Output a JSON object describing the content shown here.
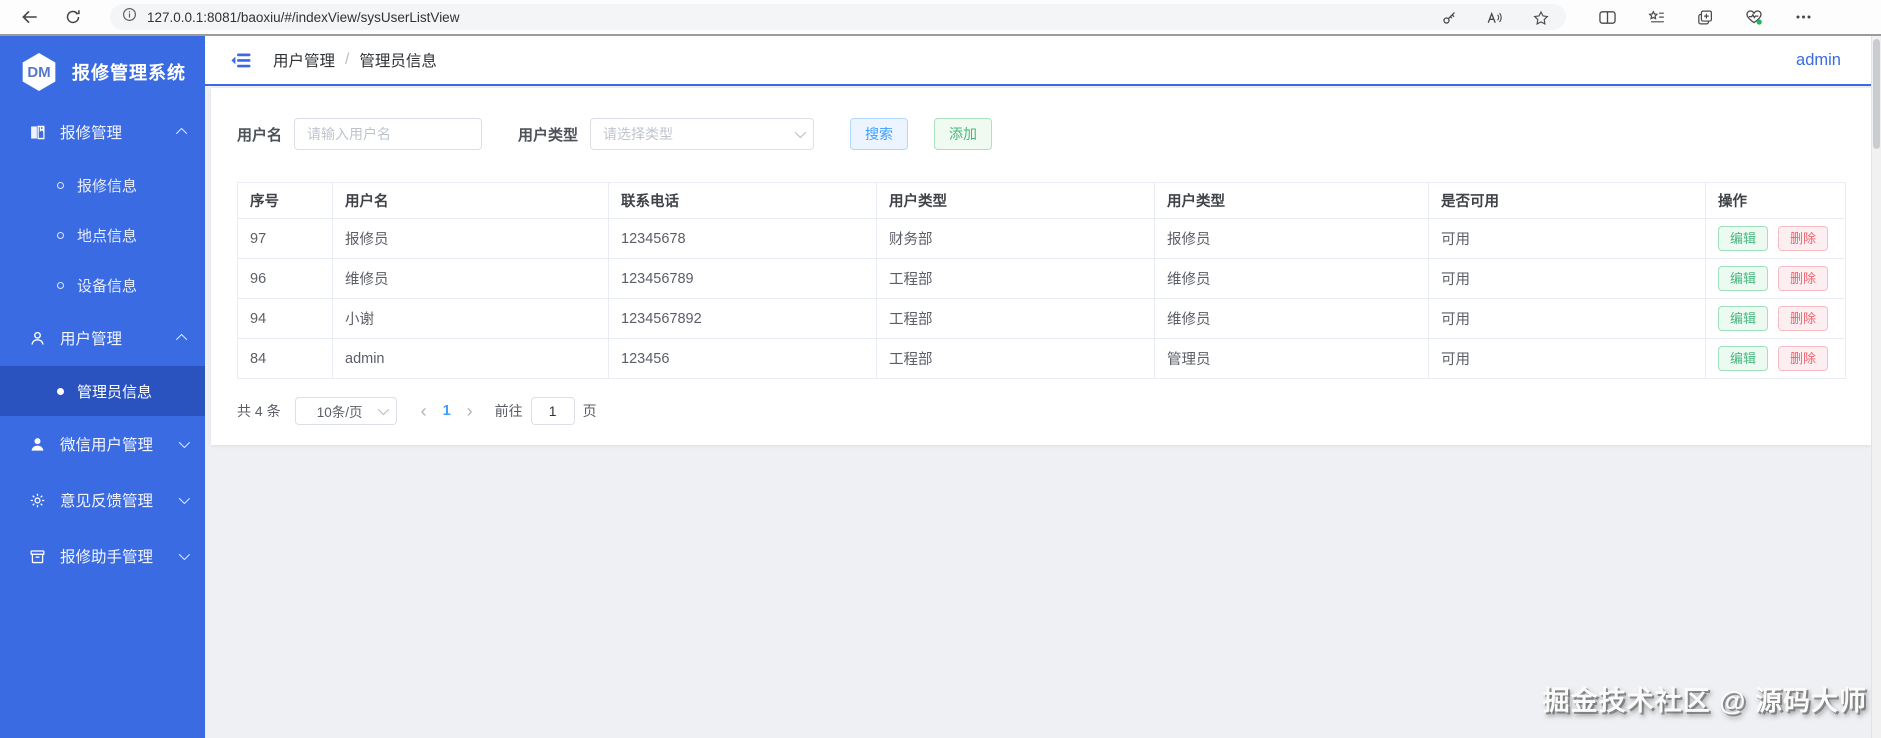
{
  "browser": {
    "url": "127.0.0.1:8081/baoxiu/#/indexView/sysUserListView",
    "icons": {
      "back": "left-arrow",
      "refresh": "circular-arrow",
      "site_info": "circled-i",
      "password_key": "key",
      "read_aloud": "A-with-sound-waves",
      "favorite_star": "star-outline",
      "split_screen": "rect-split",
      "favorites_hub": "star-with-lines",
      "collections": "stacked-panels-plus",
      "essentials": "heart-pulse-green-dot",
      "more": "ellipsis"
    }
  },
  "sidebar": {
    "logo_text": "DM",
    "title": "报修管理系统",
    "items": [
      {
        "key": "repair-management",
        "label": "报修管理",
        "type": "group",
        "icon": "book",
        "expanded": true
      },
      {
        "key": "repair-info",
        "label": "报修信息",
        "type": "sub",
        "active": false
      },
      {
        "key": "location-info",
        "label": "地点信息",
        "type": "sub",
        "active": false
      },
      {
        "key": "device-info",
        "label": "设备信息",
        "type": "sub",
        "active": false
      },
      {
        "key": "user-management",
        "label": "用户管理",
        "type": "group",
        "icon": "user-outline",
        "expanded": true
      },
      {
        "key": "admin-info",
        "label": "管理员信息",
        "type": "sub",
        "active": true
      },
      {
        "key": "wechat-user-management",
        "label": "微信用户管理",
        "type": "group",
        "icon": "user-filled",
        "expanded": false
      },
      {
        "key": "feedback-management",
        "label": "意见反馈管理",
        "type": "group",
        "icon": "gear",
        "expanded": false
      },
      {
        "key": "repair-assistant-management",
        "label": "报修助手管理",
        "type": "group",
        "icon": "box",
        "expanded": false
      }
    ]
  },
  "header": {
    "breadcrumb": [
      "用户管理",
      "管理员信息"
    ],
    "separator": "/",
    "username": "admin"
  },
  "search": {
    "username_label": "用户名",
    "username_placeholder": "请输入用户名",
    "type_label": "用户类型",
    "type_placeholder": "请选择类型",
    "search_button": "搜索",
    "add_button": "添加"
  },
  "table": {
    "columns": [
      "序号",
      "用户名",
      "联系电话",
      "用户类型",
      "用户类型",
      "是否可用",
      "操作"
    ],
    "rows": [
      {
        "cells": [
          "97",
          "报修员",
          "12345678",
          "财务部",
          "报修员",
          "可用"
        ]
      },
      {
        "cells": [
          "96",
          "维修员",
          "123456789",
          "工程部",
          "维修员",
          "可用"
        ]
      },
      {
        "cells": [
          "94",
          "小谢",
          "1234567892",
          "工程部",
          "维修员",
          "可用"
        ]
      },
      {
        "cells": [
          "84",
          "admin",
          "123456",
          "工程部",
          "管理员",
          "可用"
        ]
      }
    ],
    "edit_label": "编辑",
    "delete_label": "删除"
  },
  "pagination": {
    "total_text": "共 4 条",
    "page_size": "10条/页",
    "prev": "‹",
    "next": "›",
    "current_page": "1",
    "goto_label": "前往",
    "goto_value": "1",
    "page_unit": "页"
  },
  "watermark": "掘金技术社区 @ 源码大师",
  "colors": {
    "sidebar_bg": "#3a6be2",
    "sidebar_active_bg": "#2b53c0",
    "primary_accent": "#3a6be2",
    "link_blue": "#409eff",
    "success_green": "#48b87f",
    "danger_red": "#f0616d"
  }
}
